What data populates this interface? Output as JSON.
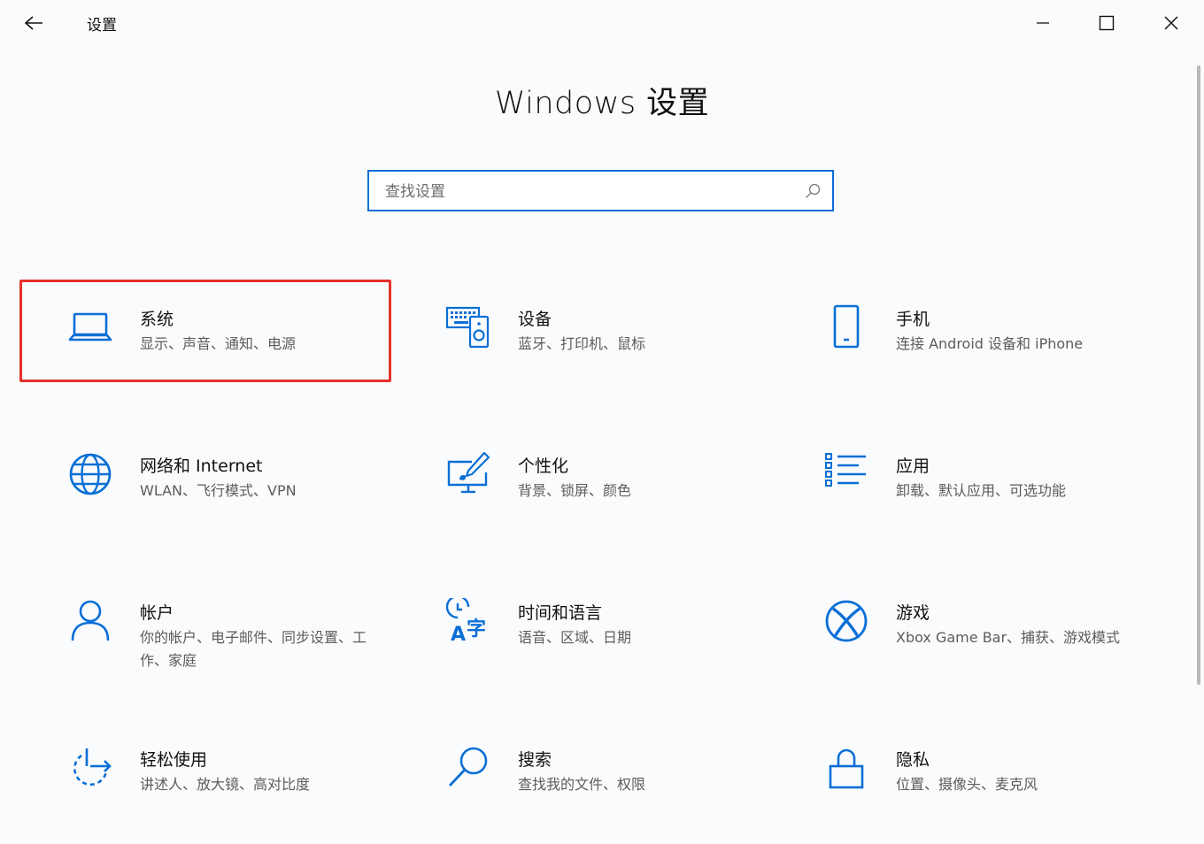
{
  "window": {
    "title": "设置"
  },
  "page": {
    "heading": "Windows 设置"
  },
  "search": {
    "placeholder": "查找设置"
  },
  "colors": {
    "accent": "#0a6fd6",
    "highlight_border": "#e5312b"
  },
  "tiles": [
    {
      "title": "系统",
      "desc": "显示、声音、通知、电源",
      "icon": "laptop-icon"
    },
    {
      "title": "设备",
      "desc": "蓝牙、打印机、鼠标",
      "icon": "devices-icon"
    },
    {
      "title": "手机",
      "desc": "连接 Android 设备和 iPhone",
      "icon": "phone-icon"
    },
    {
      "title": "网络和 Internet",
      "desc": "WLAN、飞行模式、VPN",
      "icon": "globe-icon"
    },
    {
      "title": "个性化",
      "desc": "背景、锁屏、颜色",
      "icon": "personalization-icon"
    },
    {
      "title": "应用",
      "desc": "卸载、默认应用、可选功能",
      "icon": "apps-list-icon"
    },
    {
      "title": "帐户",
      "desc": "你的帐户、电子邮件、同步设置、工作、家庭",
      "icon": "person-icon"
    },
    {
      "title": "时间和语言",
      "desc": "语音、区域、日期",
      "icon": "time-language-icon"
    },
    {
      "title": "游戏",
      "desc": "Xbox Game Bar、捕获、游戏模式",
      "icon": "xbox-icon"
    },
    {
      "title": "轻松使用",
      "desc": "讲述人、放大镜、高对比度",
      "icon": "ease-of-access-icon"
    },
    {
      "title": "搜索",
      "desc": "查找我的文件、权限",
      "icon": "search-icon"
    },
    {
      "title": "隐私",
      "desc": "位置、摄像头、麦克风",
      "icon": "lock-icon"
    }
  ]
}
